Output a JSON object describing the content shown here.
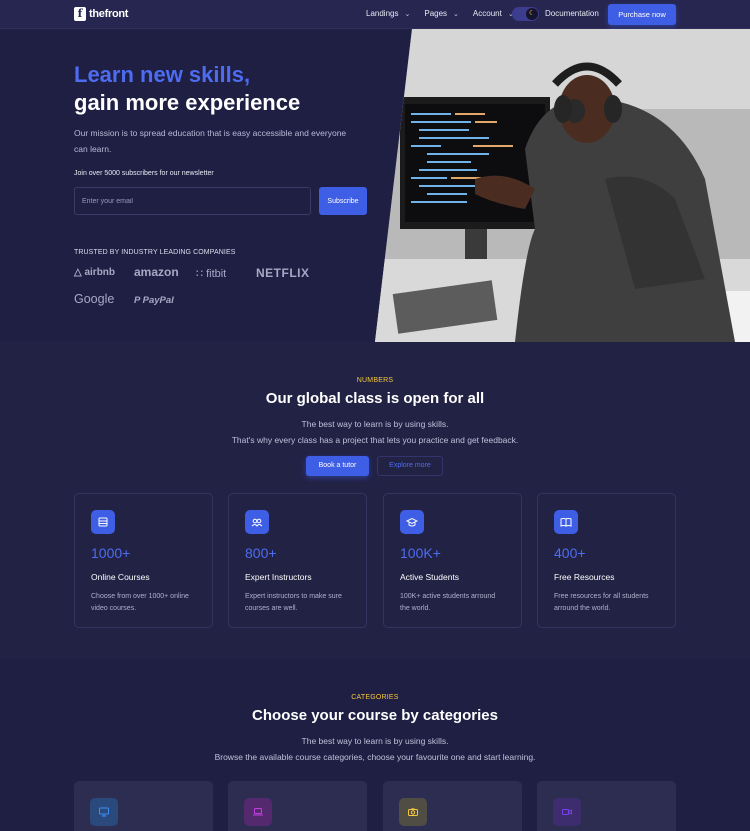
{
  "nav": {
    "logo_text": "thefront",
    "menu": [
      {
        "label": "Landings"
      },
      {
        "label": "Pages"
      },
      {
        "label": "Account"
      }
    ],
    "documentation": "Documentation",
    "purchase": "Purchase now"
  },
  "hero": {
    "title_line1": "Learn new skills,",
    "title_line2": "gain more experience",
    "description": "Our mission is to spread education that is easy accessible and everyone can learn.",
    "newsletter_text": "Join over 5000 subscribers for our newsletter",
    "email_placeholder": "Enter your email",
    "subscribe": "Subscribe",
    "trusted_label": "TRUSTED BY INDUSTRY LEADING COMPANIES",
    "brands": [
      "airbnb",
      "amazon",
      "fitbit",
      "NETFLIX",
      "Google",
      "PayPal"
    ]
  },
  "numbers": {
    "overline": "NUMBERS",
    "title": "Our global class is open for all",
    "desc_line1": "The best way to learn is by using skills.",
    "desc_line2": "That's why every class has a project that lets you practice and get feedback.",
    "btn_tutor": "Book a tutor",
    "btn_explore": "Explore more",
    "stats": [
      {
        "icon": "courses-icon",
        "value": "1000+",
        "label": "Online Courses",
        "desc": "Choose from over 1000+ online video courses."
      },
      {
        "icon": "instructors-icon",
        "value": "800+",
        "label": "Expert Instructors",
        "desc": "Expert instructors to make sure courses are well."
      },
      {
        "icon": "students-icon",
        "value": "100K+",
        "label": "Active Students",
        "desc": "100K+ active students arround the world."
      },
      {
        "icon": "resources-icon",
        "value": "400+",
        "label": "Free Resources",
        "desc": "Free resources for all students arround the world."
      }
    ]
  },
  "categories": {
    "overline": "CATEGORIES",
    "title": "Choose your course by categories",
    "desc_line1": "The best way to learn is by using skills.",
    "desc_line2": "Browse the available course categories, choose your favourite one and start learning.",
    "cards": [
      {
        "icon": "monitor-icon",
        "color": "#2f7fd8"
      },
      {
        "icon": "laptop-icon",
        "color": "#b92fd8"
      },
      {
        "icon": "camera-icon",
        "color": "#f4c63b"
      },
      {
        "icon": "video-icon",
        "color": "#7a3fe6"
      }
    ]
  },
  "colors": {
    "accent": "#3f5ee6",
    "accent_text": "#4d6cf0",
    "highlight": "#f4c63b",
    "background": "#222245"
  }
}
